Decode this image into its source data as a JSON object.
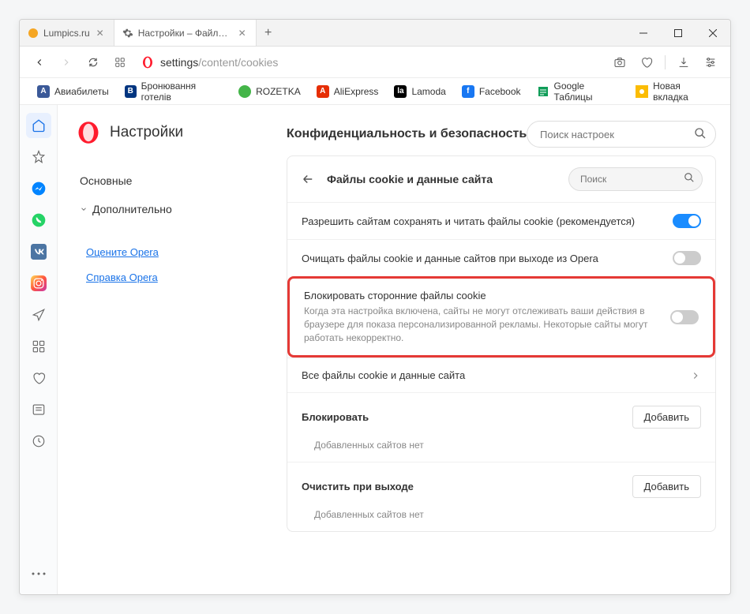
{
  "tabs": [
    {
      "title": "Lumpics.ru",
      "favicon_color": "#f5a623"
    },
    {
      "title": "Настройки – Файлы cookie",
      "favicon": "gear"
    }
  ],
  "addressbar": {
    "prefix": "settings",
    "path": "/content/cookies"
  },
  "bookmarks": [
    {
      "label": "Авиабилеты",
      "color": "#3b5998",
      "letter": "А"
    },
    {
      "label": "Бронювання готелів",
      "color": "#003580",
      "letter": "B"
    },
    {
      "label": "ROZETKA",
      "color": "#44b549",
      "letter": ""
    },
    {
      "label": "AliExpress",
      "color": "#e62e04",
      "letter": "A"
    },
    {
      "label": "Lamoda",
      "color": "#000",
      "letter": "la"
    },
    {
      "label": "Facebook",
      "color": "#1877f2",
      "letter": "f"
    },
    {
      "label": "Google Таблицы",
      "color": "#0f9d58",
      "letter": ""
    },
    {
      "label": "Новая вкладка",
      "color": "#fbbc04",
      "letter": ""
    }
  ],
  "settings": {
    "title": "Настройки",
    "search_placeholder": "Поиск настроек",
    "nav": {
      "basic": "Основные",
      "advanced": "Дополнительно"
    },
    "links": {
      "rate": "Оцените Opera",
      "help": "Справка Opera"
    }
  },
  "section": {
    "heading": "Конфиденциальность и безопасность",
    "card_title": "Файлы cookie и данные сайта",
    "mini_search_placeholder": "Поиск",
    "row_allow": "Разрешить сайтам сохранять и читать файлы cookie (рекомендуется)",
    "row_clear_exit": "Очищать файлы cookie и данные сайтов при выходе из Opera",
    "row_block_third_title": "Блокировать сторонние файлы cookie",
    "row_block_third_desc": "Когда эта настройка включена, сайты не могут отслеживать ваши действия в браузере для показа персонализированной рекламы. Некоторые сайты могут работать некорректно.",
    "row_all_cookies": "Все файлы cookie и данные сайта",
    "block_title": "Блокировать",
    "block_add": "Добавить",
    "block_empty": "Добавленных сайтов нет",
    "clear_title": "Очистить при выходе",
    "clear_add": "Добавить",
    "clear_empty": "Добавленных сайтов нет"
  }
}
